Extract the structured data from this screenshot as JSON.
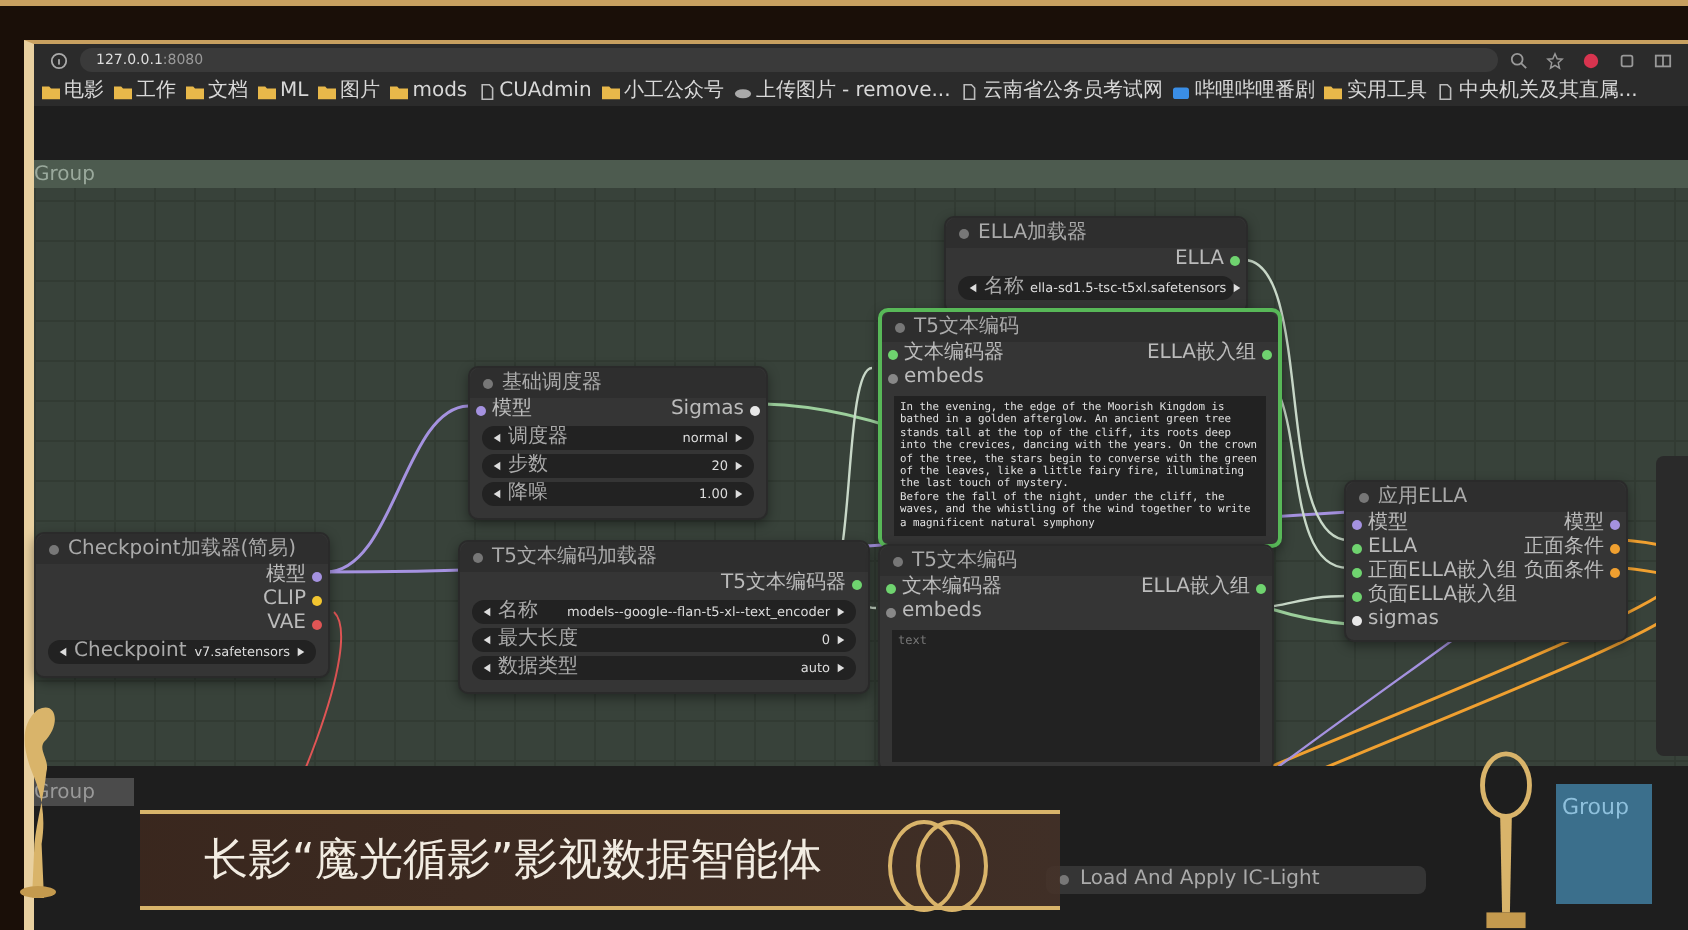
{
  "browser": {
    "url_host": "127.0.0.1",
    "url_port": ":8080",
    "bookmarks": [
      {
        "label": "电影",
        "kind": "folder"
      },
      {
        "label": "工作",
        "kind": "folder"
      },
      {
        "label": "文档",
        "kind": "folder"
      },
      {
        "label": "ML",
        "kind": "folder"
      },
      {
        "label": "图片",
        "kind": "folder"
      },
      {
        "label": "mods",
        "kind": "folder"
      },
      {
        "label": "CUAdmin",
        "kind": "page"
      },
      {
        "label": "小工公众号",
        "kind": "folder"
      },
      {
        "label": "上传图片 - remove...",
        "kind": "cloud"
      },
      {
        "label": "云南省公务员考试网",
        "kind": "page"
      },
      {
        "label": "哔哩哔哩番剧",
        "kind": "app"
      },
      {
        "label": "实用工具",
        "kind": "folder"
      },
      {
        "label": "中央机关及其直属...",
        "kind": "page"
      }
    ]
  },
  "canvas": {
    "group_label": "Group",
    "nodes": [
      {
        "title": "Checkpoint加载器(简易)",
        "selected": false,
        "outputs": [
          {
            "label": "模型",
            "color": "#a592e0"
          },
          {
            "label": "CLIP",
            "color": "#f2c530"
          },
          {
            "label": "VAE",
            "color": "#e05555"
          }
        ],
        "widgets": [
          {
            "label": "Checkpoint",
            "value": "v7.safetensors"
          }
        ]
      },
      {
        "title": "基础调度器",
        "selected": false,
        "inputs": [
          {
            "label": "模型",
            "color": "#a592e0"
          }
        ],
        "outputs": [
          {
            "label": "Sigmas",
            "color": "#e8e8e8"
          }
        ],
        "widgets": [
          {
            "label": "调度器",
            "value": "normal"
          },
          {
            "label": "步数",
            "value": "20"
          },
          {
            "label": "降噪",
            "value": "1.00"
          }
        ]
      },
      {
        "title": "T5文本编码加载器",
        "selected": false,
        "outputs": [
          {
            "label": "T5文本编码器",
            "color": "#6fd36f"
          }
        ],
        "widgets": [
          {
            "label": "名称",
            "value": "models--google--flan-t5-xl--text_encoder"
          },
          {
            "label": "最大长度",
            "value": "0"
          },
          {
            "label": "数据类型",
            "value": "auto"
          }
        ]
      },
      {
        "title": "ELLA加载器",
        "selected": false,
        "outputs": [
          {
            "label": "ELLA",
            "color": "#6fd36f"
          }
        ],
        "widgets": [
          {
            "label": "名称",
            "value": "ella-sd1.5-tsc-t5xl.safetensors"
          }
        ]
      },
      {
        "title": "T5文本编码",
        "selected": true,
        "inputs": [
          {
            "label": "文本编码器",
            "color": "#6fd36f"
          },
          {
            "label": "embeds",
            "color": "#888888"
          }
        ],
        "outputs": [
          {
            "label": "ELLA嵌入组",
            "color": "#6fd36f"
          }
        ],
        "text": "In the evening, the edge of the Moorish Kingdom is bathed in a golden afterglow. An ancient green tree stands tall at the top of the cliff, its roots deep into the crevices, dancing with the years. On the crown of the tree, the stars begin to converse with the green of the leaves, like a little fairy fire, illuminating the last touch of mystery.\nBefore the fall of the night, under the cliff, the waves, and the whistling of the wind together to write a magnificent natural symphony"
      },
      {
        "title": "T5文本编码",
        "selected": false,
        "inputs": [
          {
            "label": "文本编码器",
            "color": "#6fd36f"
          },
          {
            "label": "embeds",
            "color": "#888888"
          }
        ],
        "outputs": [
          {
            "label": "ELLA嵌入组",
            "color": "#6fd36f"
          }
        ],
        "placeholder": "text"
      },
      {
        "title": "应用ELLA",
        "selected": false,
        "inputs": [
          {
            "label": "模型",
            "color": "#a592e0"
          },
          {
            "label": "ELLA",
            "color": "#6fd36f"
          },
          {
            "label": "正面ELLA嵌入组",
            "color": "#6fd36f"
          },
          {
            "label": "负面ELLA嵌入组",
            "color": "#6fd36f"
          },
          {
            "label": "sigmas",
            "color": "#e8e8e8"
          }
        ],
        "outputs": [
          {
            "label": "模型",
            "color": "#a592e0"
          },
          {
            "label": "正面条件",
            "color": "#f0a030"
          },
          {
            "label": "负面条件",
            "color": "#f0a030"
          }
        ]
      }
    ],
    "lower_groups": [
      "Group",
      "Group"
    ],
    "lower_node": "Load And Apply IC-Light"
  },
  "caption": "长影“魔光循影”影视数据智能体"
}
